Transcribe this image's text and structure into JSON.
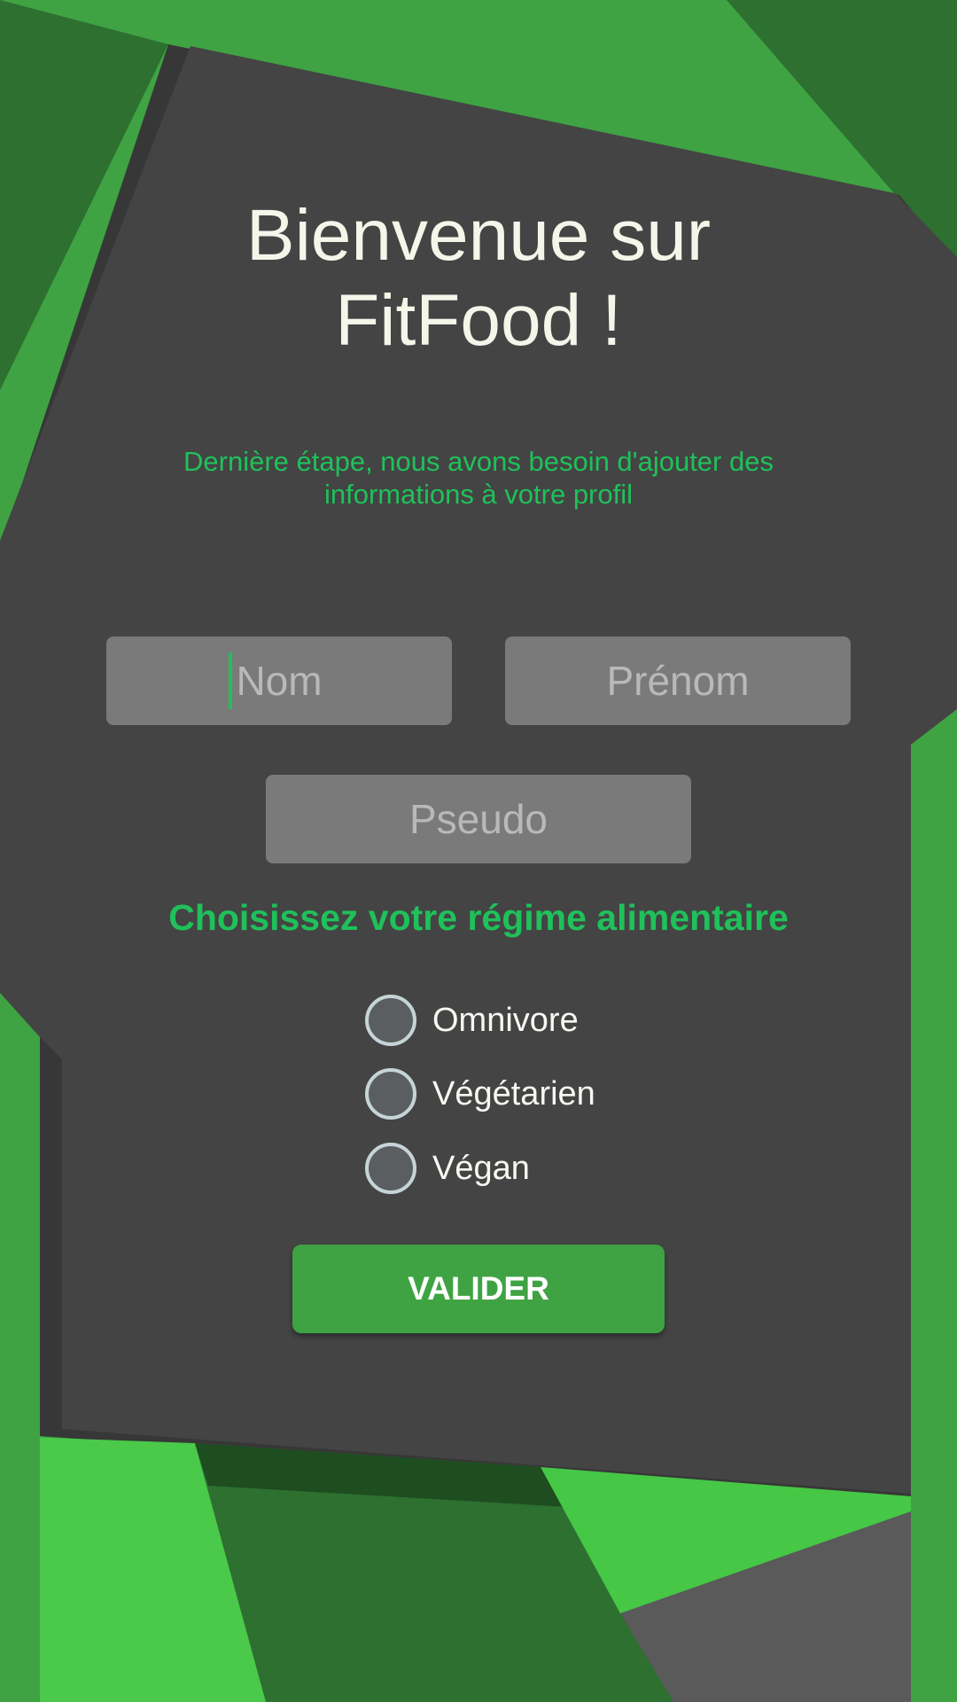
{
  "header": {
    "title_line1": "Bienvenue sur",
    "title_line2": "FitFood !",
    "subtitle_line1": "Dernière étape, nous avons besoin d'ajouter des",
    "subtitle_line2": "informations à votre profil"
  },
  "form": {
    "nom_placeholder": "Nom",
    "prenom_placeholder": "Prénom",
    "pseudo_placeholder": "Pseudo",
    "diet_heading": "Choisissez votre régime alimentaire",
    "diet_options": [
      {
        "label": "Omnivore",
        "selected": false
      },
      {
        "label": "Végétarien",
        "selected": false
      },
      {
        "label": "Végan",
        "selected": false
      }
    ],
    "submit_label": "VALIDER"
  },
  "colors": {
    "accent_green": "#1fc15a",
    "button_green": "#3fa343",
    "panel_dark": "#444444",
    "field_gray": "#7a7a7a"
  },
  "icons": {
    "background": "geometric-green-shapes"
  }
}
